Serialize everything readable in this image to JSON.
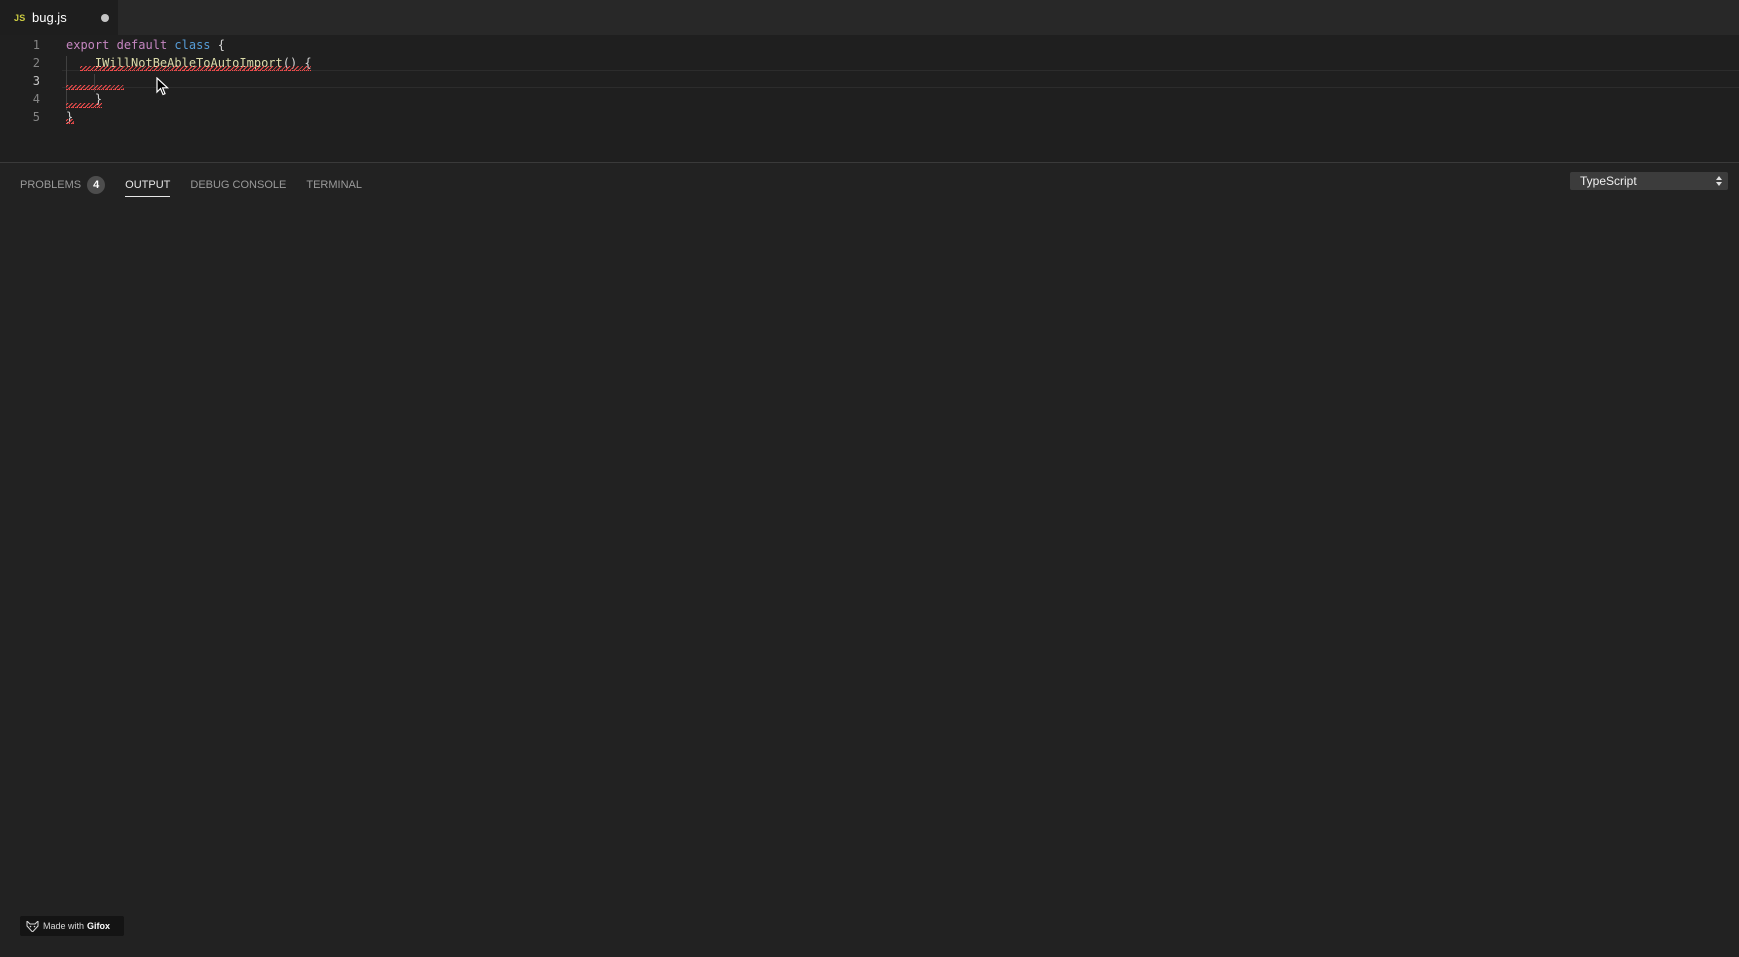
{
  "tab": {
    "icon_text": "JS",
    "label": "bug.js"
  },
  "editor": {
    "line_numbers": [
      "1",
      "2",
      "3",
      "4",
      "5"
    ],
    "lines": [
      {
        "tokens": [
          {
            "text": "export",
            "cls": "kw-pink"
          },
          {
            "text": " ",
            "cls": "punc"
          },
          {
            "text": "default",
            "cls": "kw-pink"
          },
          {
            "text": " ",
            "cls": "punc"
          },
          {
            "text": "class",
            "cls": "kw-blue"
          },
          {
            "text": " {",
            "cls": "punc"
          }
        ]
      },
      {
        "tokens": [
          {
            "text": "    ",
            "cls": "punc"
          },
          {
            "text": "IWillNotBeAbleToAutoImport",
            "cls": "fn"
          },
          {
            "text": "() {",
            "cls": "punc"
          }
        ]
      },
      {
        "tokens": []
      },
      {
        "tokens": [
          {
            "text": "    }",
            "cls": "punc"
          }
        ]
      },
      {
        "tokens": [
          {
            "text": "}",
            "cls": "punc"
          }
        ]
      }
    ]
  },
  "panel": {
    "tabs": [
      {
        "label": "PROBLEMS",
        "badge": "4",
        "active": false
      },
      {
        "label": "OUTPUT",
        "active": true
      },
      {
        "label": "DEBUG CONSOLE",
        "active": false
      },
      {
        "label": "TERMINAL",
        "active": false
      }
    ],
    "output_channel": "TypeScript"
  },
  "watermark": {
    "prefix": "Made with",
    "brand": "Gifox"
  },
  "colors": {
    "keyword_pink": "#c586c0",
    "keyword_blue": "#569cd6",
    "function_yellow": "#dcdcaa",
    "error_red": "#f14c4c",
    "js_icon": "#cbcb41"
  }
}
